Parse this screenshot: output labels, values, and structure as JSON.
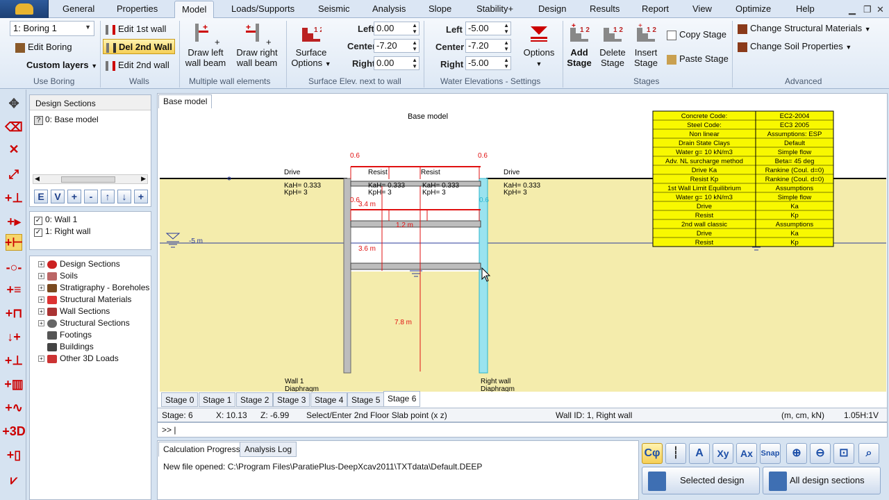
{
  "tabs": [
    "General",
    "Properties",
    "Model",
    "Loads/Supports",
    "Seismic",
    "Analysis",
    "Slope",
    "Stability+",
    "Design",
    "Results",
    "Report",
    "View",
    "Optimize",
    "Help"
  ],
  "active_tab": "Model",
  "ribbon": {
    "boring_select": "1: Boring 1",
    "edit_boring": "Edit Boring",
    "custom_layers": "Custom layers",
    "use_boring_title": "Use Boring",
    "edit_1st_wall": "Edit 1st wall",
    "del_2nd_wall": "Del 2nd Wall",
    "edit_2nd_wall": "Edit 2nd wall",
    "walls_title": "Walls",
    "draw_left_beam": "+ Draw left wall beam",
    "draw_right_beam": "+ Draw right wall beam",
    "multiple_wall_title": "Multiple wall elements",
    "surface_options": "Surface Options",
    "left_label": "Left",
    "center_label": "Center",
    "right_label": "Right",
    "surface_left": "0.00",
    "surface_center": "-7.20",
    "surface_right": "0.00",
    "surface_title": "Surface Elev. next to wall",
    "water_left": "-5.00",
    "water_center": "-7.20",
    "water_right": "-5.00",
    "options": "Options",
    "water_title": "Water Elevations - Settings",
    "add_stage": "Add Stage",
    "delete_stage": "Delete Stage",
    "insert_stage": "Insert Stage",
    "copy_stage": "Copy Stage",
    "paste_stage": "Paste Stage",
    "stages_title": "Stages",
    "change_struct_materials": "Change Structural Materials",
    "change_soil_props": "Change Soil Properties",
    "advanced_title": "Advanced"
  },
  "left_panel": {
    "design_sections_header": "Design Sections",
    "design_section_item": "0: Base model",
    "nav_buttons": [
      "E",
      "V",
      "+",
      "-",
      "↑",
      "↓",
      "+"
    ],
    "walls": [
      "0: Wall 1",
      "1: Right wall"
    ],
    "tree": [
      "Design Sections",
      "Soils",
      "Stratigraphy - Boreholes",
      "Structural Materials",
      "Wall Sections",
      "Structural Sections",
      "Footings",
      "Buildings",
      "Other 3D Loads"
    ]
  },
  "canvas": {
    "doc_tab": "Base model",
    "title": "Base model",
    "drive": "Drive",
    "resist": "Resist",
    "kah": "KaH= 0.333",
    "kph": "KpH= 3",
    "load_value": "0.6",
    "water_label": "-5 m",
    "dims": [
      "3.4 m",
      "1.2 m",
      "3.6 m",
      "7.8 m"
    ],
    "left_wall_label": "Wall 1",
    "left_wall_type": "Diaphragm",
    "right_wall_label": "Right wall",
    "right_wall_type": "Diaphragm",
    "info_table": [
      [
        "Concrete Code:",
        "EC2-2004"
      ],
      [
        "Steel Code:",
        "EC3 2005"
      ],
      [
        "Non linear",
        "Assumptions: ESP"
      ],
      [
        "Drain State Clays",
        "Default"
      ],
      [
        "Water g= 10 kN/m3",
        "Simple flow"
      ],
      [
        "Adv. NL surcharge method",
        "Beta= 45 deg"
      ],
      [
        "Drive Ka",
        "Rankine (Coul. d=0)"
      ],
      [
        "Resist Kp",
        "Rankine (Coul. d=0)"
      ],
      [
        "1st Wall Limit Equilibrium",
        "Assumptions"
      ],
      [
        "Water g= 10 kN/m3",
        "Simple flow"
      ],
      [
        "Drive",
        "Ka"
      ],
      [
        "Resist",
        "Kp"
      ],
      [
        "2nd wall classic",
        "Assumptions"
      ],
      [
        "Drive",
        "Ka"
      ],
      [
        "Resist",
        "Kp"
      ]
    ]
  },
  "stages": [
    "Stage 0",
    "Stage 1",
    "Stage 2",
    "Stage 3",
    "Stage 4",
    "Stage 5",
    "Stage 6"
  ],
  "active_stage": "Stage 6",
  "status": {
    "stage": "Stage: 6",
    "x": "X: 10.13",
    "z": "Z: -6.99",
    "prompt": "Select/Enter 2nd Floor Slab point (x z)",
    "wall_id": "Wall ID: 1, Right wall",
    "units": "(m, cm, kN)",
    "scale": "1.05H:1V"
  },
  "command_prompt": ">> |",
  "bottom": {
    "tab1": "Calculation Progress",
    "tab2": "Analysis Log",
    "message": "New file opened: C:\\Program Files\\ParatiePlus-DeepXcav2011\\TXTdata\\Default.DEEP"
  },
  "right_tools": {
    "icons": [
      "Cφ",
      "",
      "A",
      "Xy",
      "Ax",
      "Snap",
      "",
      "",
      "",
      ""
    ],
    "selected_design": "Selected design",
    "all_design_sections": "All design sections"
  },
  "colors": {
    "soil": "#f4ecac",
    "wall_right": "#9ae3ef",
    "load": "#e01010",
    "table": "#f8f800"
  }
}
